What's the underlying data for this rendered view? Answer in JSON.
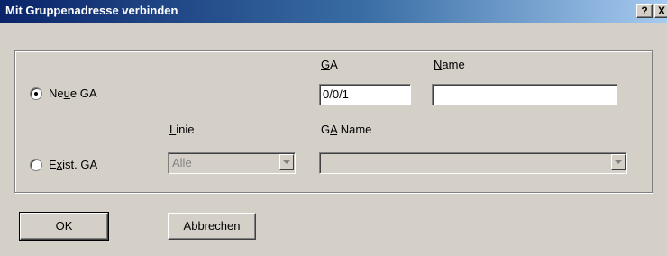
{
  "window": {
    "title": "Mit Gruppenadresse verbinden",
    "help_glyph": "?",
    "close_glyph": "X"
  },
  "new_ga": {
    "radio_label_pre": "Ne",
    "radio_label_ul": "u",
    "radio_label_post": "e GA",
    "selected": true,
    "ga_label_ul": "G",
    "ga_label_post": "A",
    "name_label_ul": "N",
    "name_label_post": "ame",
    "ga_value": "0/0/1",
    "name_value": ""
  },
  "exist_ga": {
    "radio_label_pre": "E",
    "radio_label_ul": "x",
    "radio_label_post": "ist. GA",
    "selected": false,
    "linie_label_ul": "L",
    "linie_label_post": "inie",
    "linie_value": "Alle",
    "ganame_label_pre": "G",
    "ganame_label_ul": "A",
    "ganame_label_post": " Name",
    "ganame_value": ""
  },
  "buttons": {
    "ok": "OK",
    "cancel": "Abbrechen"
  }
}
